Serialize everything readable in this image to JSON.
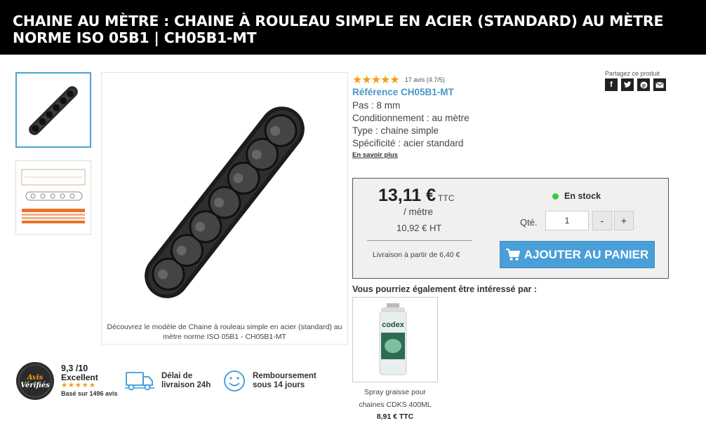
{
  "header": {
    "title": "CHAINE AU MÈTRE : CHAINE À ROULEAU SIMPLE EN ACIER (STANDARD) AU MÈTRE NORME ISO 05B1 | CH05B1-MT"
  },
  "gallery": {
    "caption": "Découvrez le modèle de Chaine à rouleau simple en acier (standard) au mètre norme ISO 05B1 - CH05B1-MT"
  },
  "rating": {
    "stars": "★★★★★",
    "value": 4.7,
    "text": "17 avis (4.7/5)"
  },
  "product": {
    "reference": "Référence CH05B1-MT",
    "specs": [
      "Pas : 8 mm",
      "Conditionnement : au mètre",
      "Type : chaine simple",
      "Spécificité : acier standard"
    ],
    "more_link": "En savoir plus"
  },
  "share": {
    "label": "Partagez ce produit",
    "icons": [
      "facebook-icon",
      "twitter-icon",
      "pinterest-icon",
      "email-icon"
    ]
  },
  "buy": {
    "price": "13,11 €",
    "price_suffix": "TTC",
    "per_unit": "/ mètre",
    "price_ht": "10,92 € HT",
    "delivery": "Livraison à partir de 6,40 €",
    "stock": "En stock",
    "qty_label": "Qté.",
    "qty_value": "1",
    "minus": "-",
    "plus": "+",
    "add_to_cart": "AJOUTER AU PANIER"
  },
  "suggest": {
    "title": "Vous pourriez également être intéressé par :",
    "item_name": "Spray graisse pour chaines CDKS 400ML",
    "item_price": "8,91 € TTC",
    "can_brand": "codex"
  },
  "trust": {
    "badge_line1": "Avis",
    "badge_line2": "Vérifiés",
    "score": "9,3 /10",
    "score_label": "Excellent",
    "stars": "★★★★★",
    "review_count": "Basé sur 1496 avis",
    "delivery_line1": "Délai de",
    "delivery_line2": "livraison 24h",
    "refund_line1": "Remboursement",
    "refund_line2": "sous 14 jours"
  },
  "colors": {
    "accent": "#4a9fd8",
    "star": "#f29d13",
    "stock": "#3ec83e",
    "title_bg": "#000000"
  }
}
